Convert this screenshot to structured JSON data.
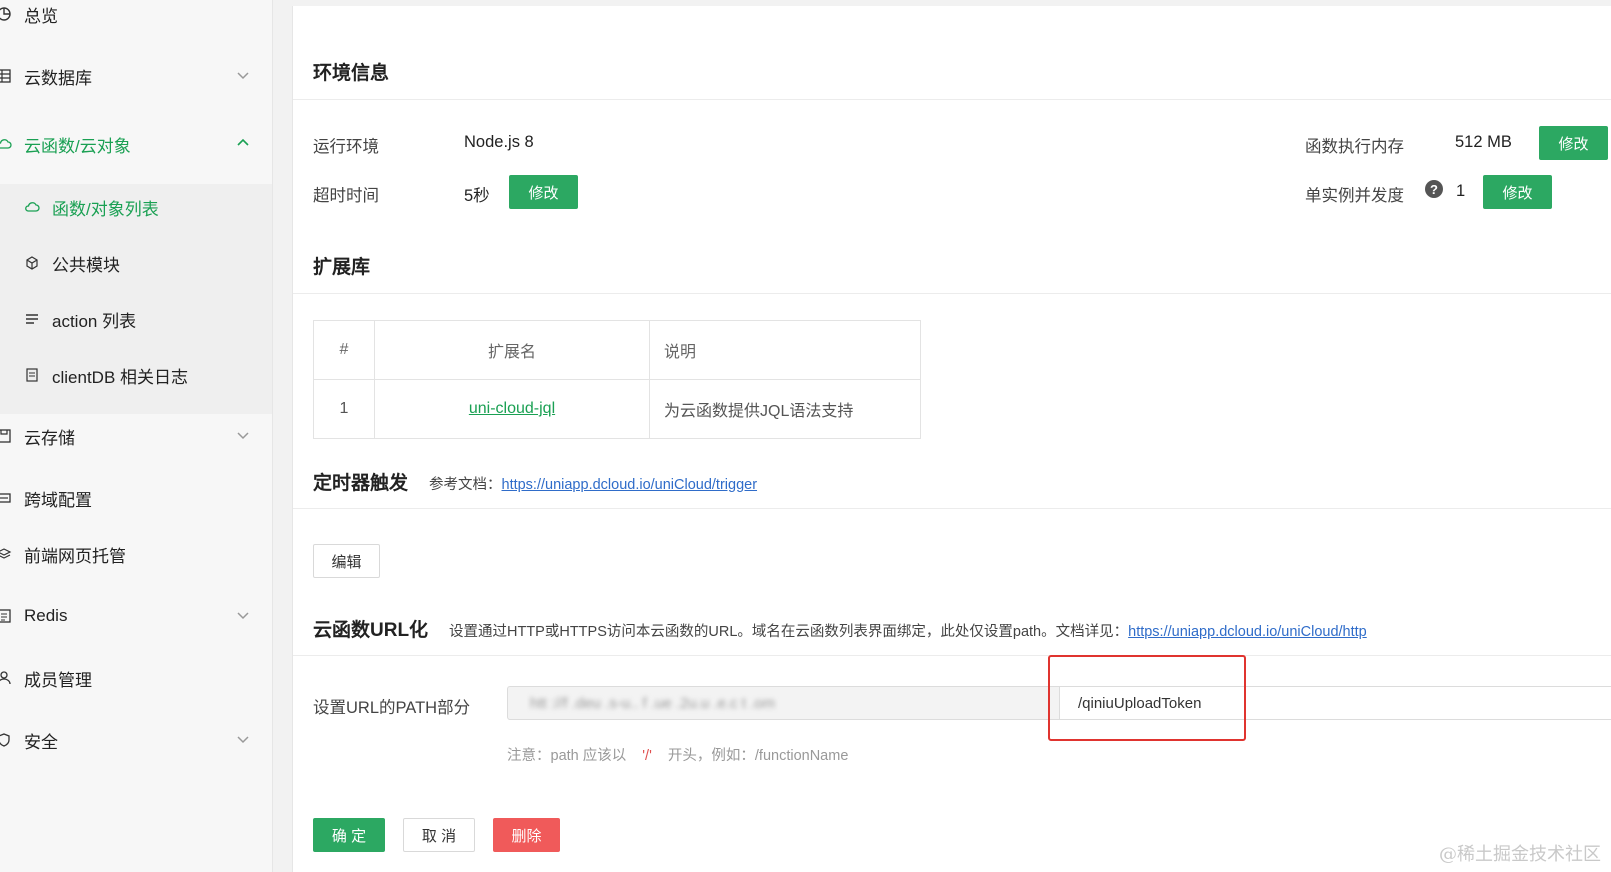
{
  "sidebar": {
    "items": [
      {
        "label": "总览",
        "icon": "pie-chart-icon"
      },
      {
        "label": "云数据库",
        "icon": "database-icon"
      },
      {
        "label": "云函数/云对象",
        "icon": "cloud-icon"
      },
      {
        "label": "云存储",
        "icon": "storage-icon"
      },
      {
        "label": "跨域配置",
        "icon": "cross-domain-icon"
      },
      {
        "label": "前端网页托管",
        "icon": "hosting-icon"
      },
      {
        "label": "Redis",
        "icon": "redis-icon"
      },
      {
        "label": "成员管理",
        "icon": "user-icon"
      },
      {
        "label": "安全",
        "icon": "shield-icon"
      }
    ],
    "submenu": [
      {
        "label": "函数/对象列表",
        "icon": "cloud-icon"
      },
      {
        "label": "公共模块",
        "icon": "cube-icon"
      },
      {
        "label": "action 列表",
        "icon": "list-icon"
      },
      {
        "label": "clientDB 相关日志",
        "icon": "log-icon"
      }
    ]
  },
  "env": {
    "title": "环境信息",
    "runtime_label": "运行环境",
    "runtime_value": "Node.js 8",
    "memory_label": "函数执行内存",
    "memory_value": "512 MB",
    "timeout_label": "超时时间",
    "timeout_value": "5秒",
    "concurrency_label": "单实例并发度",
    "concurrency_value": "1",
    "edit_label": "修改"
  },
  "ext": {
    "title": "扩展库",
    "headers": [
      "#",
      "扩展名",
      "说明"
    ],
    "rows": [
      {
        "index": "1",
        "name": "uni-cloud-jql",
        "desc": "为云函数提供JQL语法支持"
      }
    ]
  },
  "trigger": {
    "title": "定时器触发",
    "doc_label": "参考文档：",
    "doc_link": "https://uniapp.dcloud.io/uniCloud/trigger",
    "edit_label": "编辑"
  },
  "url": {
    "title": "云函数URL化",
    "desc": "设置通过HTTP或HTTPS访问本云函数的URL。域名在云函数列表界面绑定，此处仅设置path。文档详见：",
    "doc_link": "https://uniapp.dcloud.io/uniCloud/http",
    "path_label": "设置URL的PATH部分",
    "prefix": "htt ://f         .deu  .s-u..  f    .ue          .2u.u   .e.c  t     .om",
    "path_value": "/qiniuUploadToken",
    "note_prefix": "注意：path 应该以",
    "note_slash": "'/'",
    "note_suffix": "开头，例如：/functionName"
  },
  "actions": {
    "confirm": "确 定",
    "cancel": "取 消",
    "delete": "删除"
  },
  "watermark": "@稀土掘金技术社区",
  "colors": {
    "accent": "#1aa053",
    "button_green": "#2ca862",
    "button_red": "#f05a5a",
    "link_blue": "#2f6cc9",
    "highlight_box": "#e0342f"
  }
}
